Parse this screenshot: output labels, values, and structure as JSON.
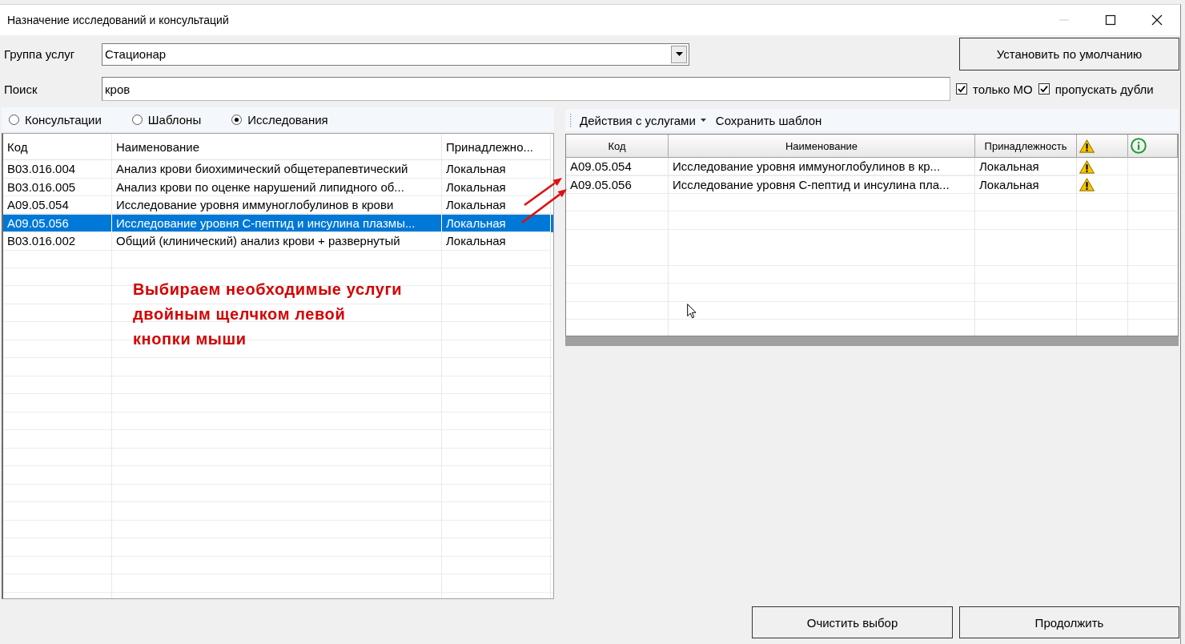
{
  "window": {
    "title": "Назначение исследований и консультаций"
  },
  "service_group": {
    "label": "Группа услуг",
    "value": "Стационар"
  },
  "default_button": "Установить по умолчанию",
  "search": {
    "label": "Поиск",
    "value": "кров"
  },
  "filters": [
    {
      "label": "только МО",
      "checked": true
    },
    {
      "label": "пропускать дубли",
      "checked": true
    }
  ],
  "categories": [
    {
      "label": "Консультации",
      "selected": false
    },
    {
      "label": "Шаблоны",
      "selected": false
    },
    {
      "label": "Исследования",
      "selected": true
    }
  ],
  "services_table": {
    "columns": [
      "Код",
      "Наименование",
      "Принадлежно..."
    ],
    "rows": [
      {
        "code": "B03.016.004",
        "name": "Анализ крови биохимический общетерапевтический",
        "affiliation": "Локальная",
        "selected": false
      },
      {
        "code": "B03.016.005",
        "name": "Анализ крови по оценке нарушений липидного об...",
        "affiliation": "Локальная",
        "selected": false
      },
      {
        "code": "A09.05.054",
        "name": "Исследование уровня иммуноглобулинов в крови",
        "affiliation": "Локальная",
        "selected": false
      },
      {
        "code": "A09.05.056",
        "name": "Исследование уровня С-пептид и инсулина плазмы...",
        "affiliation": "Локальная",
        "selected": true
      },
      {
        "code": "B03.016.002",
        "name": "Общий (клинический) анализ крови + развернутый",
        "affiliation": "Локальная",
        "selected": false
      }
    ]
  },
  "toolbar": {
    "actions_menu": "Действия с услугами",
    "save_template": "Сохранить шаблон"
  },
  "selected_table": {
    "columns": [
      {
        "kind": "text",
        "label": "Код"
      },
      {
        "kind": "text",
        "label": "Наименование"
      },
      {
        "kind": "text",
        "label": "Принадлежность"
      },
      {
        "kind": "warning"
      },
      {
        "kind": "info"
      }
    ],
    "rows": [
      {
        "code": "A09.05.054",
        "name": "Исследование уровня иммуноглобулинов в кр...",
        "affiliation": "Локальная",
        "warning": true
      },
      {
        "code": "A09.05.056",
        "name": "Исследование уровня С-пептид и инсулина пла...",
        "affiliation": "Локальная",
        "warning": true
      }
    ]
  },
  "annotation": {
    "lines": [
      "Выбираем необходимые услуги",
      "двойным щелчком левой",
      "кнопки мыши"
    ]
  },
  "buttons": [
    {
      "label": "Очистить выбор"
    },
    {
      "label": "Продолжить"
    }
  ]
}
